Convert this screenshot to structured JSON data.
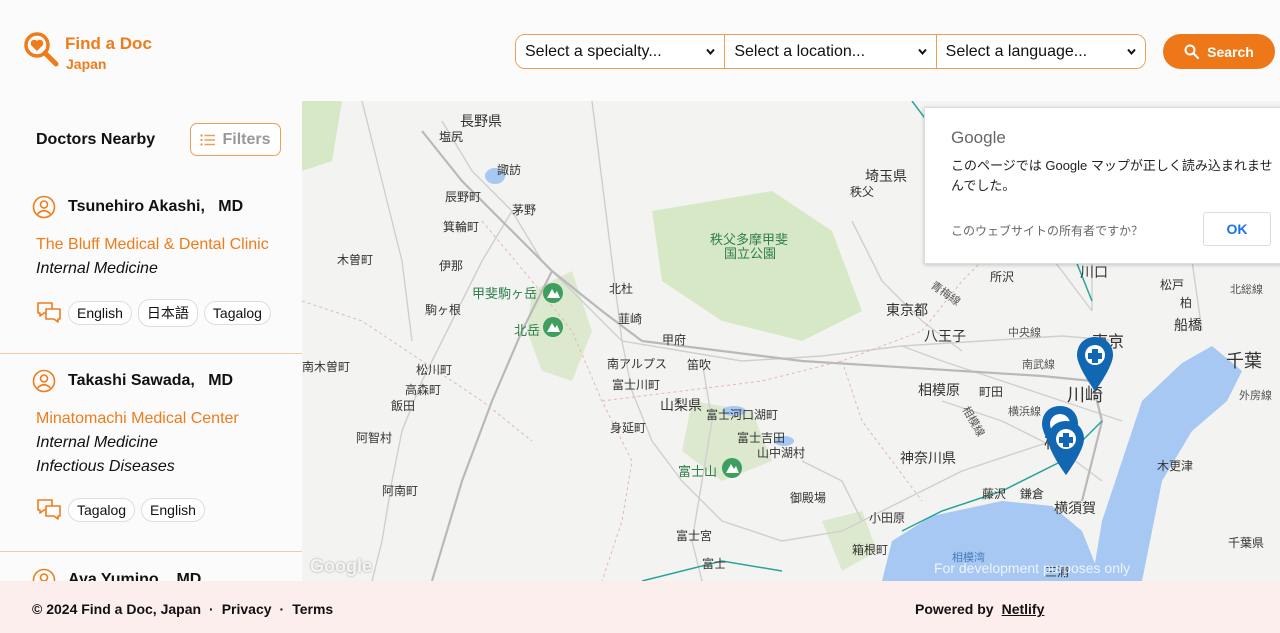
{
  "brand": {
    "title": "Find a Doc",
    "subtitle": "Japan",
    "accent": "#ee7818"
  },
  "search": {
    "specialty_placeholder": "Select a specialty...",
    "location_placeholder": "Select a location...",
    "language_placeholder": "Select a language...",
    "button_label": "Search"
  },
  "sidebar": {
    "title": "Doctors Nearby",
    "filters_label": "Filters",
    "doctors": [
      {
        "name": "Tsunehiro Akashi,   MD",
        "clinic": "The Bluff Medical & Dental Clinic",
        "specialties": [
          "Internal Medicine"
        ],
        "languages": [
          "English",
          "日本語",
          "Tagalog"
        ]
      },
      {
        "name": "Takashi Sawada,   MD",
        "clinic": "Minatomachi Medical Center",
        "specialties": [
          "Internal Medicine",
          "Infectious Diseases"
        ],
        "languages": [
          "Tagalog",
          "English"
        ]
      },
      {
        "name": "Aya Yumino,   MD"
      }
    ]
  },
  "map": {
    "popup_brand": "Google",
    "popup_message": "このページでは Google マップが正しく読み込まれませんでした。",
    "popup_owner_question": "このウェブサイトの所有者ですか？",
    "popup_ok": "OK",
    "watermark": "Google",
    "dev_notice": "For development purposes only",
    "labels": [
      "長野県",
      "塩尻",
      "諏訪",
      "辰野町",
      "茅野",
      "箕輪町",
      "木曽町",
      "伊那",
      "駒ヶ根",
      "南木曽町",
      "松川町",
      "高森町",
      "飯田",
      "阿智村",
      "阿南町",
      "甲斐駒ヶ岳",
      "北岳",
      "北杜",
      "韮崎",
      "甲府",
      "南アルプス",
      "笛吹",
      "富士川町",
      "山梨県",
      "身延町",
      "富士河口湖町",
      "富士吉田",
      "山中湖村",
      "富士山",
      "御殿場",
      "富士宮",
      "富士",
      "秩父多摩甲斐",
      "国立公園",
      "埼玉県",
      "秩父",
      "東京都",
      "八王子",
      "所沢",
      "川口",
      "松戸",
      "柏",
      "東京",
      "船橋",
      "千葉",
      "相模原",
      "町田",
      "川崎",
      "横浜",
      "神奈川県",
      "藤沢",
      "鎌倉",
      "小田原",
      "箱根町",
      "横須賀",
      "相模湾",
      "三浦",
      "木更津",
      "千葉県",
      "中央線",
      "南武線",
      "横浜線",
      "北総線",
      "外房線",
      "相模線",
      "青梅線"
    ]
  },
  "footer": {
    "copyright": "© 2024 Find a Doc, Japan",
    "dot": "·",
    "privacy": "Privacy",
    "terms": "Terms",
    "powered_by": "Powered by",
    "netlify": "Netlify"
  }
}
